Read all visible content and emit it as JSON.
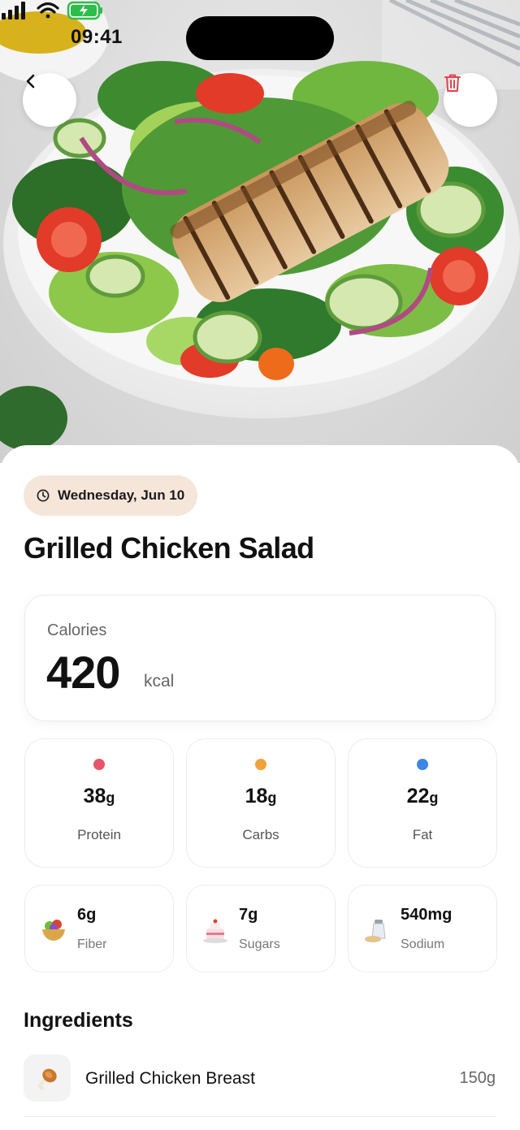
{
  "status_bar": {
    "time": "09:41"
  },
  "header": {
    "back_icon": "chevron-left-icon",
    "delete_icon": "trash-icon",
    "delete_color": "#e0434c"
  },
  "meal": {
    "date": "Wednesday, Jun 10",
    "date_icon": "clock-icon",
    "title": "Grilled Chicken Salad"
  },
  "calories": {
    "label": "Calories",
    "value": "420",
    "unit": "kcal"
  },
  "macros": [
    {
      "value": "38",
      "unit": "g",
      "label": "Protein",
      "color": "#e8546a"
    },
    {
      "value": "18",
      "unit": "g",
      "label": "Carbs",
      "color": "#f0a23a"
    },
    {
      "value": "22",
      "unit": "g",
      "label": "Fat",
      "color": "#3d86e6"
    }
  ],
  "micros": [
    {
      "value": "6g",
      "label": "Fiber",
      "icon": "salad-bowl-icon"
    },
    {
      "value": "7g",
      "label": "Sugars",
      "icon": "cake-icon"
    },
    {
      "value": "540mg",
      "label": "Sodium",
      "icon": "salt-shaker-icon"
    }
  ],
  "ingredients": {
    "title": "Ingredients",
    "items": [
      {
        "name": "Grilled Chicken Breast",
        "amount": "150g",
        "icon": "chicken-leg-icon"
      }
    ]
  }
}
